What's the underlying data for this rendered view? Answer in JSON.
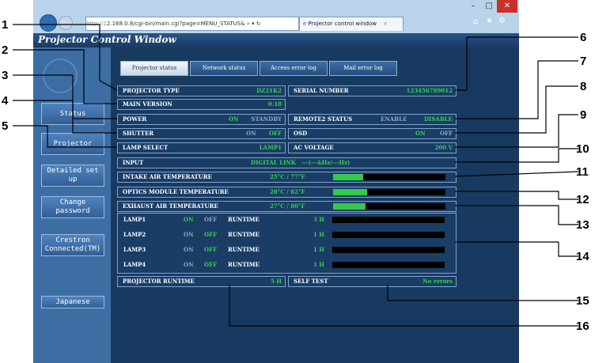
{
  "browser": {
    "url": "2.168.0.8/cgi-bin/main.cgi?page=MENU_STATUS&",
    "tab_title": "Projector control window",
    "addr_prefix": "http://1"
  },
  "window_title": "Projector Control Window",
  "tabs": [
    {
      "label": "Projector status",
      "active": true
    },
    {
      "label": "Network status",
      "active": false
    },
    {
      "label": "Access error log",
      "active": false
    },
    {
      "label": "Mail error log",
      "active": false
    }
  ],
  "sidebar": {
    "items": [
      {
        "label": "Status"
      },
      {
        "label": "Projector"
      },
      {
        "label": "Detailed set up"
      },
      {
        "label": "Change password"
      },
      {
        "label": "Crestron Connected(TM)"
      },
      {
        "label": "Japanese"
      }
    ]
  },
  "status": {
    "projector_type_label": "PROJECTOR TYPE",
    "projector_type_value": "DZ21K2",
    "serial_number_label": "SERIAL NUMBER",
    "serial_number_value": "123456789012",
    "main_version_label": "MAIN VERSION",
    "main_version_value": "0.18",
    "power_label": "POWER",
    "power_on": "ON",
    "power_standby": "STANDBY",
    "remote2_label": "REMOTE2 STATUS",
    "remote2_enable": "ENABLE",
    "remote2_disable": "DISABLE",
    "shutter_label": "SHUTTER",
    "shutter_on": "ON",
    "shutter_off": "OFF",
    "osd_label": "OSD",
    "osd_on": "ON",
    "osd_off": "OFF",
    "lamp_select_label": "LAMP SELECT",
    "lamp_select_value": "LAMP1",
    "ac_voltage_label": "AC VOLTAGE",
    "ac_voltage_value": "200 V",
    "input_label": "INPUT",
    "input_value": "DIGITAL LINK",
    "input_freq": "---(---kHz/---Hz)",
    "intake_label": "INTAKE AIR TEMPERATURE",
    "intake_value": "25°C / 77°F",
    "intake_level": 0.27,
    "optics_label": "OPTICS MODULE TEMPERATURE",
    "optics_value": "28°C / 82°F",
    "optics_level": 0.3,
    "exhaust_label": "EXHAUST AIR TEMPERATURE",
    "exhaust_value": "27°C / 80°F",
    "exhaust_level": 0.29,
    "lamps": [
      {
        "name": "LAMP1",
        "on": "ON",
        "off": "OFF",
        "state": "on",
        "runtime_label": "RUNTIME",
        "runtime": "3 H"
      },
      {
        "name": "LAMP2",
        "on": "ON",
        "off": "OFF",
        "state": "off",
        "runtime_label": "RUNTIME",
        "runtime": "1 H"
      },
      {
        "name": "LAMP3",
        "on": "ON",
        "off": "OFF",
        "state": "off",
        "runtime_label": "RUNTIME",
        "runtime": "1 H"
      },
      {
        "name": "LAMP4",
        "on": "ON",
        "off": "OFF",
        "state": "off",
        "runtime_label": "RUNTIME",
        "runtime": "1 H"
      }
    ],
    "projector_runtime_label": "PROJECTOR RUNTIME",
    "projector_runtime_value": "5 H",
    "self_test_label": "SELF TEST",
    "self_test_value": "No errors"
  },
  "callouts": [
    "1",
    "2",
    "3",
    "4",
    "5",
    "6",
    "7",
    "8",
    "9",
    "10",
    "11",
    "12",
    "13",
    "14",
    "15",
    "16"
  ],
  "colors": {
    "active_green": "#33d04e",
    "inactive_gray": "#8fa7c4",
    "panel_bg": "#1a3d66"
  }
}
